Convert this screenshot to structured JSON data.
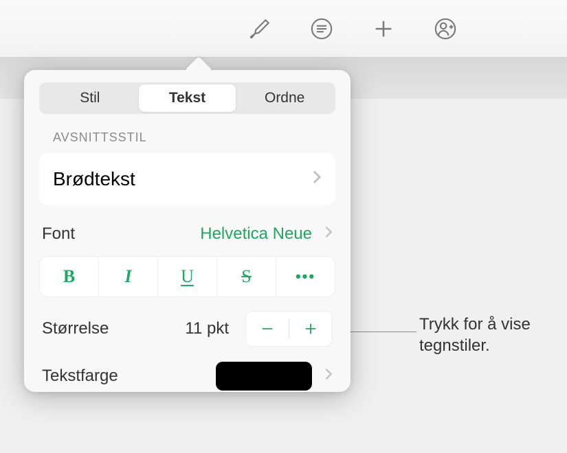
{
  "toolbar": {
    "icons": [
      "paintbrush-icon",
      "list-icon",
      "plus-icon",
      "collaborate-icon"
    ]
  },
  "tabs": {
    "items": [
      "Stil",
      "Tekst",
      "Ordne"
    ],
    "active_index": 1
  },
  "paragraph_style": {
    "section_label": "AVSNITTSSTIL",
    "value": "Brødtekst"
  },
  "font": {
    "label": "Font",
    "value": "Helvetica Neue"
  },
  "format": {
    "bold": "B",
    "italic": "I",
    "underline": "U",
    "strikethrough": "S",
    "more": "•••"
  },
  "size": {
    "label": "Størrelse",
    "value": "11 pkt"
  },
  "text_color": {
    "label": "Tekstfarge",
    "swatch": "#000000"
  },
  "callout": {
    "line1": "Trykk for å vise",
    "line2": "tegnstiler."
  }
}
